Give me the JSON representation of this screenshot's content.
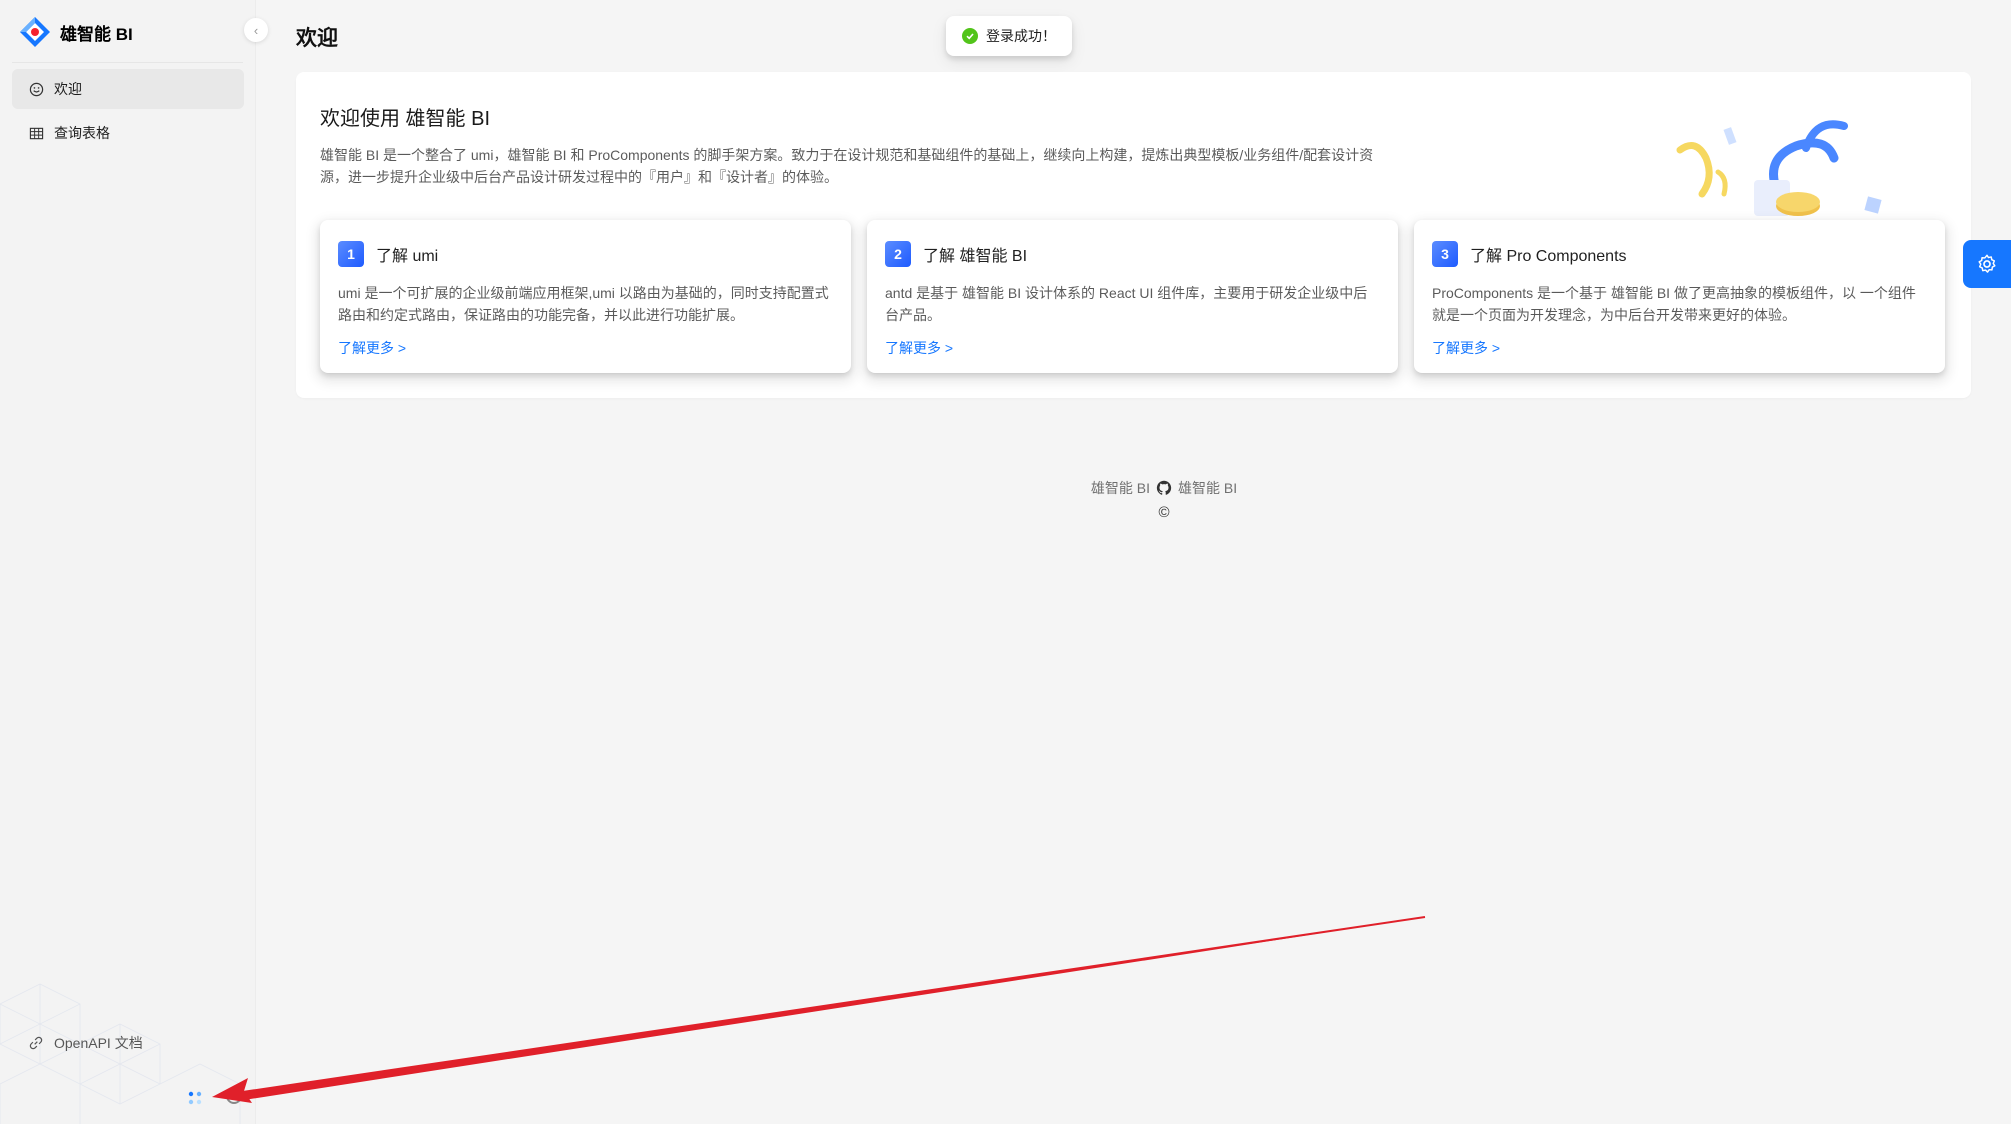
{
  "sidebar": {
    "app_title": "雄智能 BI",
    "collapse_glyph": "‹",
    "menu": [
      {
        "label": "欢迎",
        "icon": "smile-icon",
        "active": true
      },
      {
        "label": "查询表格",
        "icon": "table-icon",
        "active": false
      }
    ],
    "footer_link": {
      "label": "OpenAPI 文档",
      "icon": "link-icon"
    }
  },
  "header": {
    "page_title": "欢迎"
  },
  "toast": {
    "message": "登录成功！",
    "icon": "check-circle-icon",
    "color": "#52c41a"
  },
  "welcome": {
    "heading": "欢迎使用 雄智能 BI",
    "description": "雄智能 BI 是一个整合了 umi，雄智能 BI 和 ProComponents 的脚手架方案。致力于在设计规范和基础组件的基础上，继续向上构建，提炼出典型模板/业务组件/配套设计资源，进一步提升企业级中后台产品设计研发过程中的『用户』和『设计者』的体验。",
    "cards": [
      {
        "index": "1",
        "title": "了解 umi",
        "desc": "umi 是一个可扩展的企业级前端应用框架,umi 以路由为基础的，同时支持配置式路由和约定式路由，保证路由的功能完备，并以此进行功能扩展。",
        "link": "了解更多 >"
      },
      {
        "index": "2",
        "title": "了解 雄智能 BI",
        "desc": "antd 是基于 雄智能 BI 设计体系的 React UI 组件库，主要用于研发企业级中后台产品。",
        "link": "了解更多 >"
      },
      {
        "index": "3",
        "title": "了解 Pro Components",
        "desc": "ProComponents 是一个基于 雄智能 BI 做了更高抽象的模板组件，以 一个组件就是一个页面为开发理念，为中后台开发带来更好的体验。",
        "link": "了解更多 >"
      }
    ]
  },
  "footer": {
    "left": "雄智能 BI",
    "right": "雄智能 BI",
    "icon": "github-icon",
    "copyright": "©"
  },
  "colors": {
    "accent": "#1677ff",
    "annotation_arrow": "#e0202a"
  },
  "settings": {
    "icon": "gear-icon"
  }
}
